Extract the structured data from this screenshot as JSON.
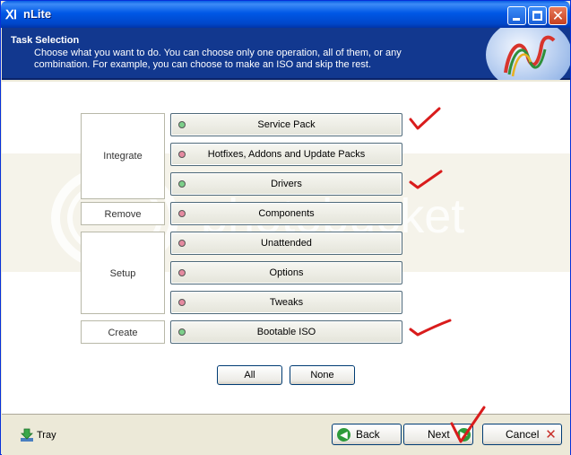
{
  "window": {
    "title": "nLite"
  },
  "header": {
    "title": "Task Selection",
    "description": "Choose what you want to do. You can choose only one operation, all of them, or any combination. For example, you can choose to make an ISO and skip the rest."
  },
  "groups": [
    "Integrate",
    "Remove",
    "Setup",
    "Create"
  ],
  "operations": [
    {
      "label": "Service Pack",
      "selected": true
    },
    {
      "label": "Hotfixes, Addons and Update Packs",
      "selected": false
    },
    {
      "label": "Drivers",
      "selected": true
    },
    {
      "label": "Components",
      "selected": false
    },
    {
      "label": "Unattended",
      "selected": false
    },
    {
      "label": "Options",
      "selected": false
    },
    {
      "label": "Tweaks",
      "selected": false
    },
    {
      "label": "Bootable ISO",
      "selected": true
    }
  ],
  "select_buttons": {
    "all": "All",
    "none": "None"
  },
  "watermark": "photobucket",
  "footer": {
    "tray": "Tray",
    "back": "Back",
    "next": "Next",
    "cancel": "Cancel"
  },
  "colors": {
    "selected_dot": "#7ccf8a",
    "unselected_dot": "#e48aa0",
    "header_bg": "#12388f",
    "annotation": "#d91c1c"
  },
  "icons": {
    "back": "back-arrow-icon",
    "next": "next-arrow-icon",
    "cancel": "cancel-x-icon",
    "tray": "tray-down-arrow-icon"
  }
}
